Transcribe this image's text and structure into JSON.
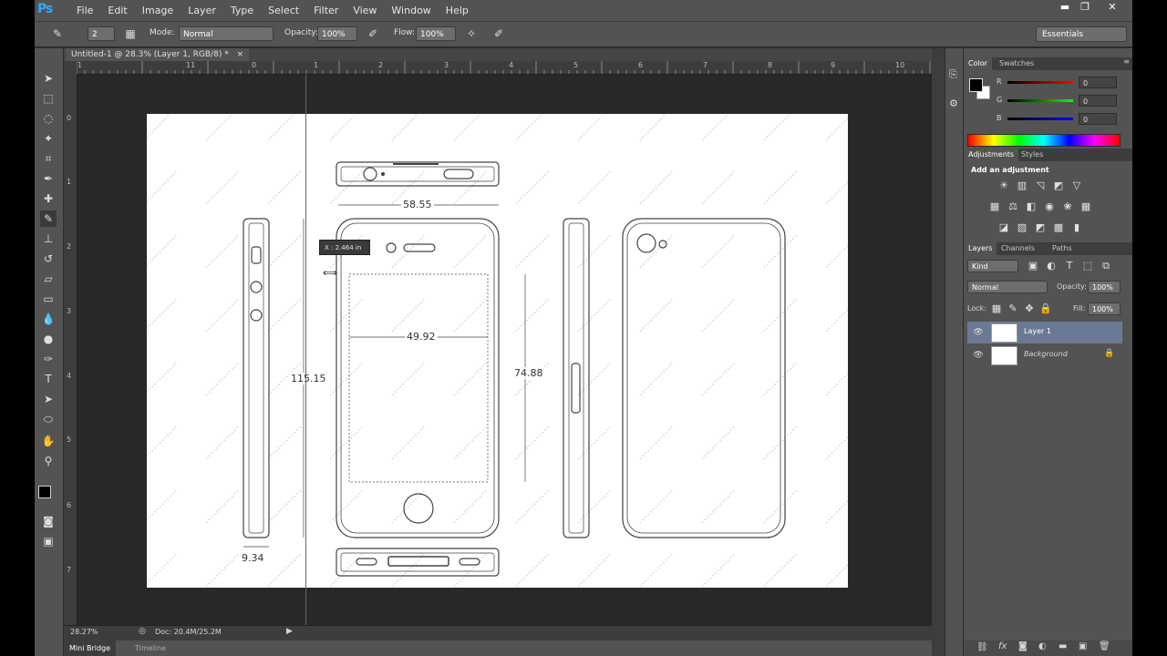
{
  "app": {
    "logo": "Ps"
  },
  "menu": [
    "File",
    "Edit",
    "Image",
    "Layer",
    "Type",
    "Select",
    "Filter",
    "View",
    "Window",
    "Help"
  ],
  "window_controls": {
    "minimize": "▬",
    "restore": "❐",
    "close": "✕"
  },
  "options_bar": {
    "brush_size": "2",
    "mode_label": "Mode:",
    "mode_value": "Normal",
    "opacity_label": "Opacity:",
    "opacity_value": "100%",
    "flow_label": "Flow:",
    "flow_value": "100%",
    "workspace": "Essentials"
  },
  "document": {
    "tab_title": "Untitled-1 @ 28.3% (Layer 1, RGB/8) *",
    "zoom": "28.27%",
    "doc_size": "Doc: 20.4M/25.2M",
    "cursor_readout": "X : 2.464 in"
  },
  "rulers": {
    "horizontal": [
      "1",
      "0",
      "1",
      "2",
      "3",
      "4",
      "5",
      "6",
      "7",
      "8",
      "9",
      "10",
      "11"
    ],
    "vertical": [
      "0",
      "1",
      "2",
      "3",
      "4",
      "5",
      "6",
      "7"
    ]
  },
  "drawing": {
    "width_label": "58.55",
    "screen_width_label": "49.92",
    "height_label": "115.15",
    "screen_height_label": "74.88",
    "depth_label": "9.34"
  },
  "bottom_tabs": [
    "Mini Bridge",
    "Timeline"
  ],
  "color_panel": {
    "tabs": [
      "Color",
      "Swatches"
    ],
    "channels": [
      {
        "label": "R",
        "value": "0",
        "color": "#e03030"
      },
      {
        "label": "G",
        "value": "0",
        "color": "#30c030"
      },
      {
        "label": "B",
        "value": "0",
        "color": "#3030e0"
      }
    ]
  },
  "adjustments_panel": {
    "tabs": [
      "Adjustments",
      "Styles"
    ],
    "heading": "Add an adjustment"
  },
  "layers_panel": {
    "tabs": [
      "Layers",
      "Channels",
      "Paths"
    ],
    "filter_kind": "Kind",
    "blend_mode": "Normal",
    "opacity_label": "Opacity:",
    "opacity_value": "100%",
    "lock_label": "Lock:",
    "fill_label": "Fill:",
    "fill_value": "100%",
    "layers": [
      {
        "name": "Layer 1",
        "selected": true
      },
      {
        "name": "Background",
        "locked": true
      }
    ],
    "footer_icons": [
      "link-icon",
      "fx-icon",
      "mask-icon",
      "adjustment-icon",
      "group-icon",
      "new-layer-icon",
      "trash-icon"
    ]
  },
  "colors": {
    "selection": "#6a7a94",
    "accent": "#31a8ff"
  }
}
